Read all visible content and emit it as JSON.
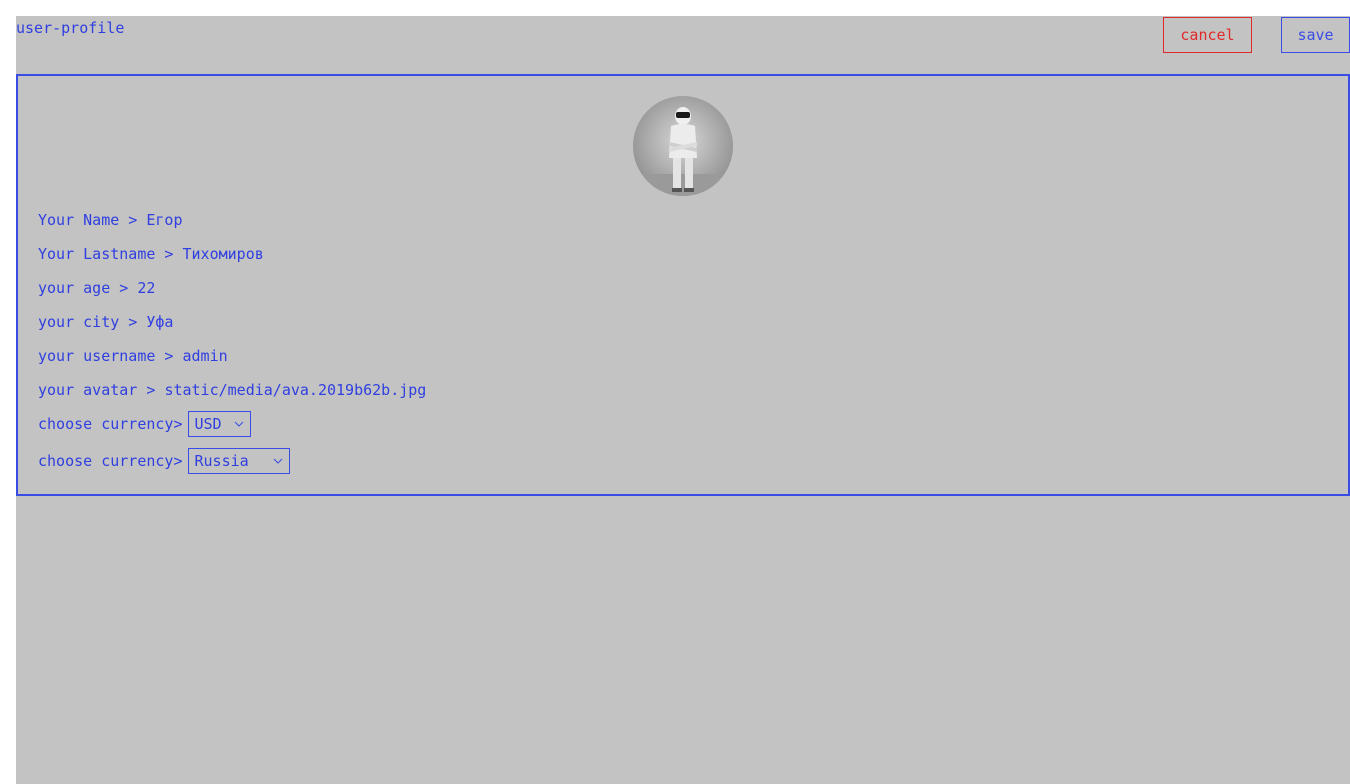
{
  "header": {
    "title": "user-profile",
    "cancel_label": "cancel",
    "save_label": "save"
  },
  "profile": {
    "fields": [
      {
        "label": "Your Name > ",
        "value": "Егор"
      },
      {
        "label": "Your Lastname > ",
        "value": "Тихомиров"
      },
      {
        "label": "your age > ",
        "value": "22"
      },
      {
        "label": "your city > ",
        "value": "Уфа"
      },
      {
        "label": "your username > ",
        "value": "admin"
      },
      {
        "label": "your avatar > ",
        "value": "static/media/ava.2019b62b.jpg"
      }
    ],
    "currency": {
      "label": "choose currency>",
      "selected": "USD"
    },
    "country": {
      "label": "choose currency>",
      "selected": "Russia"
    }
  },
  "colors": {
    "accent": "#3a4ce6",
    "danger": "#e02a2a",
    "background": "#c3c3c3"
  },
  "icons": [
    "chevron-down-icon",
    "avatar-photo"
  ]
}
